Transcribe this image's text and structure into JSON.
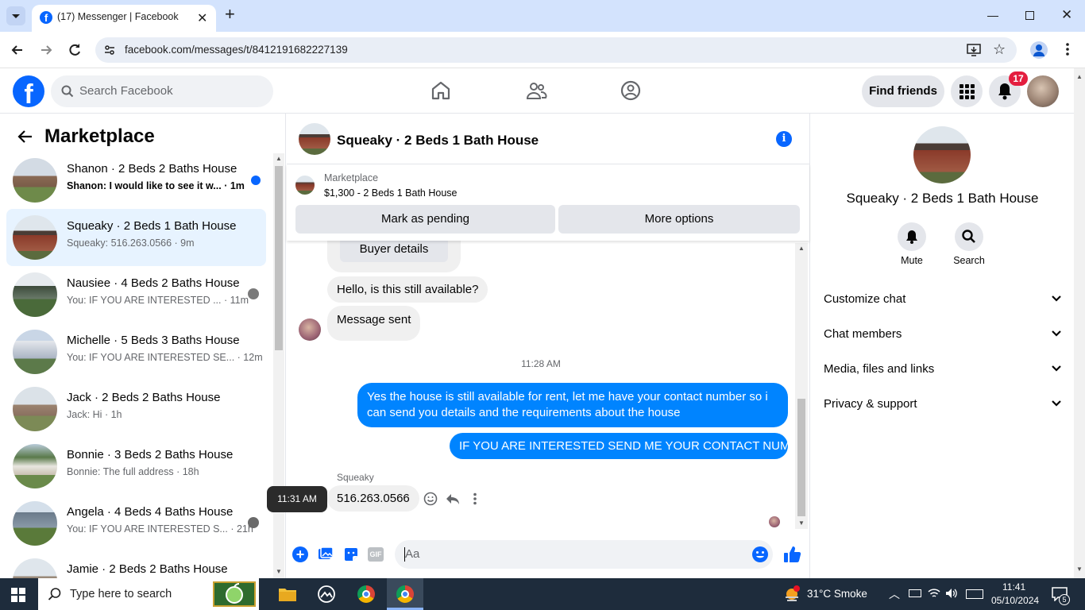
{
  "browser": {
    "tab_title": "(17) Messenger | Facebook",
    "url": "facebook.com/messages/t/8412191682227139"
  },
  "header": {
    "search_placeholder": "Search Facebook",
    "find_friends": "Find friends",
    "notification_count": "17"
  },
  "left": {
    "title": "Marketplace",
    "conversations": [
      {
        "title": "Shanon · 2 Beds 2 Baths House",
        "preview": "Shanon: I would like to see it w...",
        "time": "· 1m",
        "unread": true
      },
      {
        "title": "Squeaky · 2 Beds 1 Bath House",
        "preview": "Squeaky: 516.263.0566",
        "time": "· 9m",
        "active": true
      },
      {
        "title": "Nausiee · 4 Beds 2 Baths House",
        "preview": "You: IF YOU ARE INTERESTED ...",
        "time": "· 11m"
      },
      {
        "title": "Michelle · 5 Beds 3 Baths House",
        "preview": "You: IF YOU ARE INTERESTED SE...",
        "time": "· 12m"
      },
      {
        "title": "Jack · 2 Beds 2 Baths House",
        "preview": "Jack: Hi",
        "time": "· 1h"
      },
      {
        "title": "Bonnie · 3 Beds 2 Baths House",
        "preview": "Bonnie: The full address",
        "time": "· 18h"
      },
      {
        "title": "Angela · 4 Beds 4 Baths House",
        "preview": "You: IF YOU ARE INTERESTED S...",
        "time": "· 21h"
      },
      {
        "title": "Jamie · 2 Beds 2 Baths House",
        "preview": "",
        "time": ""
      }
    ]
  },
  "chat": {
    "title": "Squeaky · 2 Beds 1 Bath House",
    "marketplace_label": "Marketplace",
    "listing": "$1,300 - 2 Beds 1 Bath House",
    "mark_pending": "Mark as pending",
    "more_options": "More options",
    "buyer_details": "Buyer details",
    "msg_available": "Hello, is this still available?",
    "msg_sent": "Message sent",
    "timestamp": "11:28 AM",
    "out_msg_1": "Yes the house is still available for rent, let me have your contact number so i can send you details and the requirements about the house",
    "out_msg_2": "IF YOU ARE INTERESTED SEND ME YOUR CONTACT NUMBER",
    "sender_name": "Squeaky",
    "phone_msg": "516.263.0566",
    "tooltip_time": "11:31 AM",
    "input_placeholder": "Aa"
  },
  "right": {
    "title": "Squeaky · 2 Beds 1 Bath House",
    "mute": "Mute",
    "search": "Search",
    "sections": [
      "Customize chat",
      "Chat members",
      "Media, files and links",
      "Privacy & support"
    ]
  },
  "taskbar": {
    "search_placeholder": "Type here to search",
    "weather": "31°C  Smoke",
    "time": "11:41",
    "date": "05/10/2024",
    "notif_count": "5"
  },
  "colors": {
    "fb_blue": "#0866ff",
    "bubble_blue": "#0084ff",
    "active_bg": "#e7f3ff"
  }
}
